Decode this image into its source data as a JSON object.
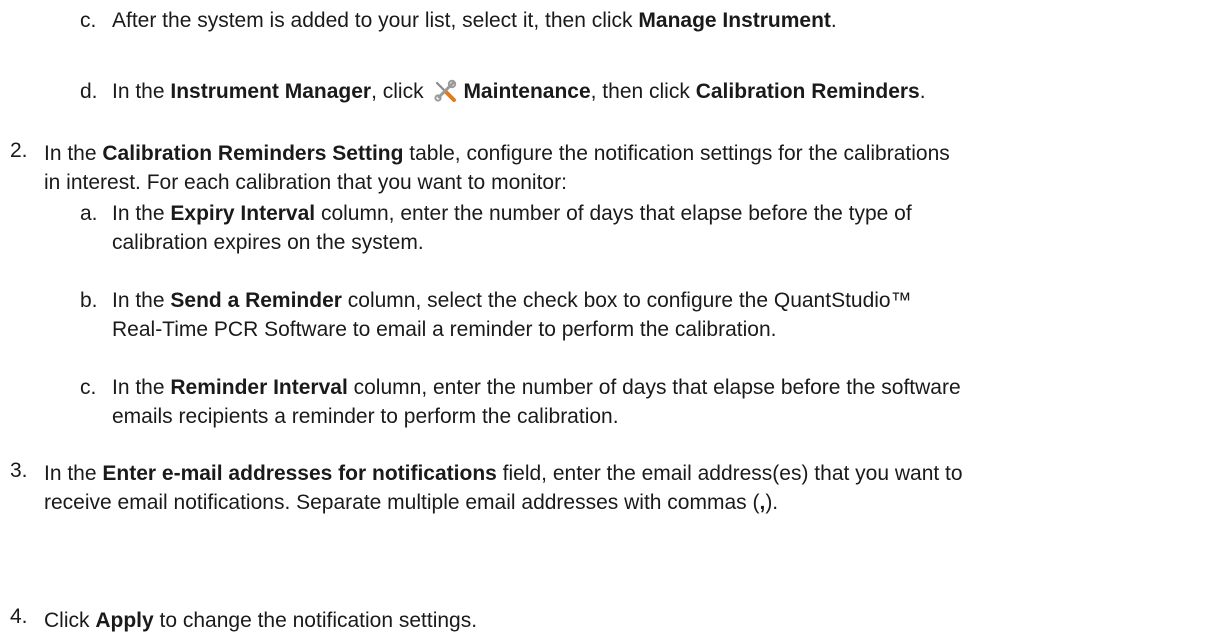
{
  "steps": [
    {
      "num": "c.",
      "runs": [
        {
          "t": "After the system is added to your list, select it, then click ",
          "b": false
        },
        {
          "t": "Manage Instrument",
          "b": true
        },
        {
          "t": ".",
          "b": false
        }
      ]
    },
    {
      "num": "d.",
      "runs": [
        {
          "t": "In the ",
          "b": false
        },
        {
          "t": "Instrument Manager",
          "b": true
        },
        {
          "t": ", click ",
          "b": false
        },
        {
          "icon": "wrench-screwdriver-icon"
        },
        {
          "t": "Maintenance",
          "b": true
        },
        {
          "t": ", then click ",
          "b": false
        },
        {
          "t": "Calibration Reminders",
          "b": true
        },
        {
          "t": ".",
          "b": false
        }
      ]
    },
    {
      "num": "2.",
      "lines": [
        [
          {
            "t": "In the ",
            "b": false
          },
          {
            "t": "Calibration Reminders Setting",
            "b": true
          },
          {
            "t": " table, configure the notification settings for the calibrations",
            "b": false
          }
        ],
        [
          {
            "t": "in interest. For each calibration that you want to monitor:",
            "b": false
          }
        ]
      ]
    },
    {
      "num": "a.",
      "lines": [
        [
          {
            "t": "In the ",
            "b": false
          },
          {
            "t": "Expiry Interval",
            "b": true
          },
          {
            "t": " column, enter the number of days that elapse before the type of",
            "b": false
          }
        ],
        [
          {
            "t": "calibration expires on the system.",
            "b": false
          }
        ]
      ]
    },
    {
      "num": "b.",
      "lines": [
        [
          {
            "t": "In the ",
            "b": false
          },
          {
            "t": "Send a Reminder",
            "b": true
          },
          {
            "t": " column, select the check box to configure the QuantStudio™",
            "b": false
          }
        ],
        [
          {
            "t": "Real-Time PCR Software to email a reminder to perform the calibration.",
            "b": false
          }
        ]
      ]
    },
    {
      "num": "c.",
      "lines": [
        [
          {
            "t": "In the ",
            "b": false
          },
          {
            "t": "Reminder Interval",
            "b": true
          },
          {
            "t": " column, enter the number of days that elapse before the software",
            "b": false
          }
        ],
        [
          {
            "t": "emails recipients a reminder to perform the calibration.",
            "b": false
          }
        ]
      ]
    },
    {
      "num": "3.",
      "lines": [
        [
          {
            "t": "In the ",
            "b": false
          },
          {
            "t": "Enter e-mail addresses for notifications",
            "b": true
          },
          {
            "t": " field, enter the email address(es) that you want to",
            "b": false
          }
        ],
        [
          {
            "t": "receive email notifications. Separate multiple email addresses with commas (",
            "b": false
          },
          {
            "t": ",",
            "b": true
          },
          {
            "t": ").",
            "b": false
          }
        ]
      ]
    },
    {
      "num": "4.",
      "lines": [
        [
          {
            "t": "Click ",
            "b": false
          },
          {
            "t": "Apply",
            "b": true
          },
          {
            "t": " to change the notification settings.",
            "b": false
          }
        ]
      ]
    }
  ]
}
